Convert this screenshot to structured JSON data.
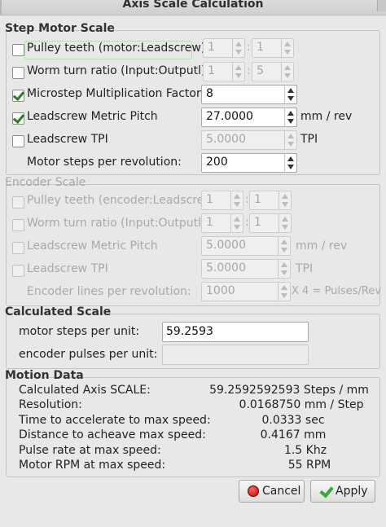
{
  "window": {
    "title": "Axis Scale Calculation"
  },
  "step_motor_scale": {
    "title": "Step Motor Scale",
    "pulley": {
      "label": "Pulley teeth (motor:Leadscrew):",
      "checked": false,
      "a": "1",
      "b": "1"
    },
    "worm": {
      "label": "Worm turn ratio (Input:Outputl)",
      "checked": false,
      "a": "1",
      "b": "5"
    },
    "microstep": {
      "label": "Microstep Multiplication Factor:",
      "checked": true,
      "value": "8"
    },
    "metric_pitch": {
      "label": "Leadscrew Metric Pitch",
      "checked": true,
      "value": "27.0000",
      "unit": "mm / rev"
    },
    "tpi": {
      "label": "Leadscrew TPI",
      "checked": false,
      "value": "5.0000",
      "unit": "TPI"
    },
    "steps_per_rev": {
      "label": "Motor steps per revolution:",
      "value": "200"
    }
  },
  "encoder_scale": {
    "title": "Encoder Scale",
    "pulley": {
      "label": "Pulley teeth (encoder:Leadscrew):",
      "a": "1",
      "b": "1"
    },
    "worm": {
      "label": "Worm turn ratio (Input:Outputl)",
      "a": "1",
      "b": "1"
    },
    "metric_pitch": {
      "label": "Leadscrew Metric Pitch",
      "value": "5.0000",
      "unit": "mm / rev"
    },
    "tpi": {
      "label": "Leadscrew TPI",
      "value": "5.0000",
      "unit": "TPI"
    },
    "lines": {
      "label": "Encoder lines per revolution:",
      "value": "1000",
      "unit": "X 4 = Pulses/Rev"
    }
  },
  "calculated_scale": {
    "title": "Calculated Scale",
    "motor_label": "motor steps per unit:",
    "motor_value": "59.2593",
    "encoder_label": "encoder pulses per unit:",
    "encoder_value": ""
  },
  "motion_data": {
    "title": "Motion Data",
    "rows": [
      {
        "label": "Calculated Axis SCALE:",
        "value": "59.2592592593 Steps / mm"
      },
      {
        "label": "Resolution:",
        "value": "0.0168750 mm / Step"
      },
      {
        "label": "Time to accelerate to max speed:",
        "value": "0.0333 sec"
      },
      {
        "label": "Distance to acheave max speed:",
        "value": "0.4167 mm"
      },
      {
        "label": "Pulse rate at max speed:",
        "value": "1.5 Khz"
      },
      {
        "label": "Motor RPM at max speed:",
        "value": "55 RPM"
      }
    ]
  },
  "buttons": {
    "cancel": "Cancel",
    "apply": "Apply"
  },
  "icons": {
    "cancel": "red-circle-icon",
    "apply": "green-check-icon"
  }
}
